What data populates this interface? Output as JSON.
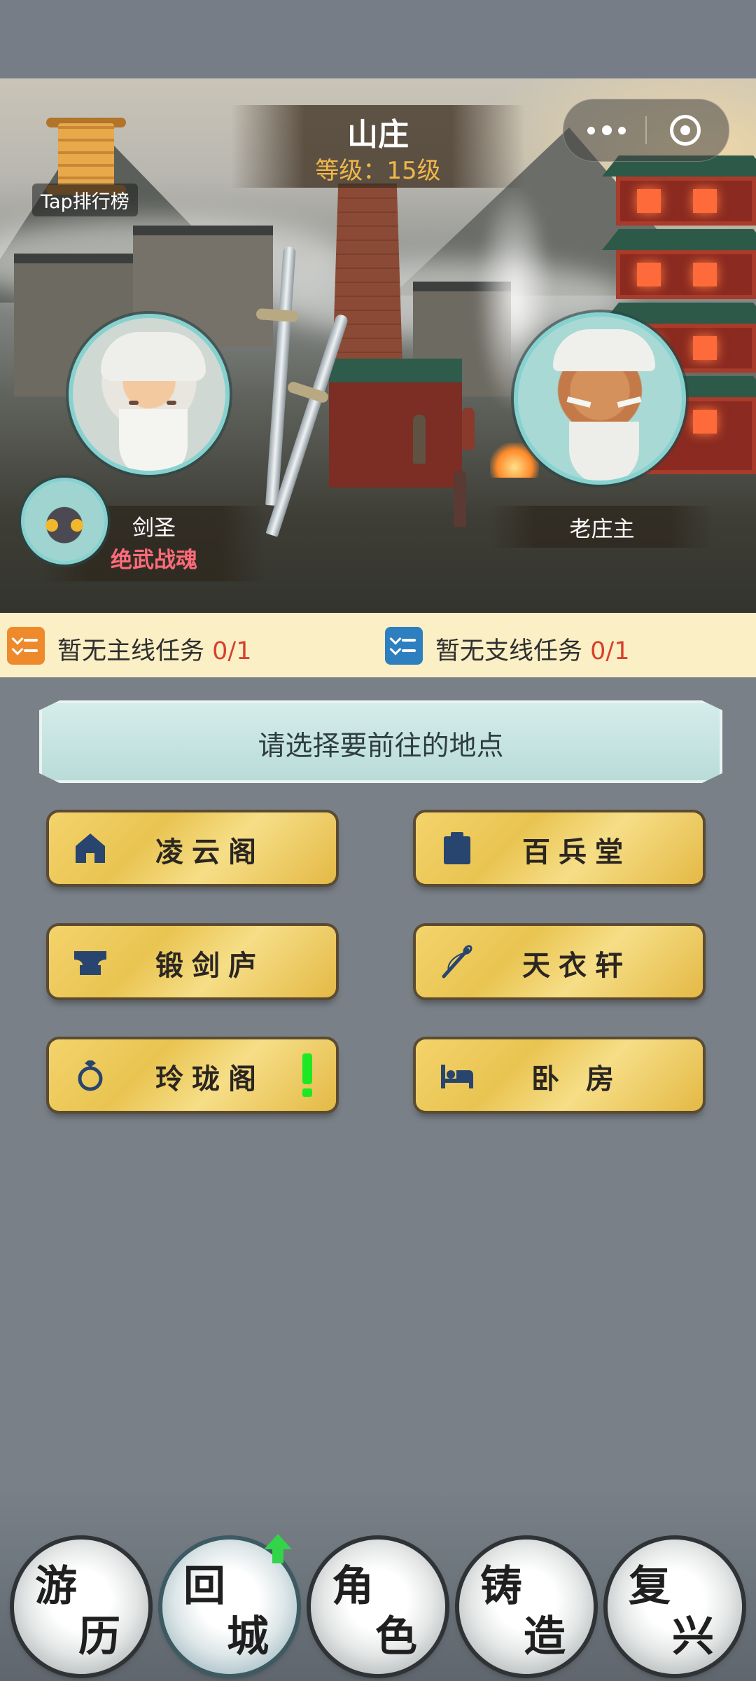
{
  "header": {
    "title": "山庄",
    "level": "等级：15级",
    "leaderboard_label": "Tap排行榜"
  },
  "capsule": {
    "more_icon": "more-dots-icon",
    "close_icon": "target-close-icon"
  },
  "npcs": [
    {
      "name": "剑圣",
      "title": "绝武战魂"
    },
    {
      "name": "老庄主"
    }
  ],
  "tasks": [
    {
      "text": "暂无主线任务",
      "count": "0/1",
      "icon_color": "#ee8a2c"
    },
    {
      "text": "暂无支线任务",
      "count": "0/1",
      "icon_color": "#2d7fc0"
    }
  ],
  "prompt": "请选择要前往的地点",
  "locations": [
    {
      "label": "凌云阁",
      "icon": "house-icon"
    },
    {
      "label": "百兵堂",
      "icon": "clipboard-icon"
    },
    {
      "label": "锻剑庐",
      "icon": "anvil-icon"
    },
    {
      "label": "天衣轩",
      "icon": "needle-icon"
    },
    {
      "label": "玲珑阁",
      "icon": "ring-icon",
      "alert": true
    },
    {
      "label": "卧 房",
      "icon": "bed-icon"
    }
  ],
  "nav": [
    {
      "c1": "游",
      "c2": "历"
    },
    {
      "c1": "回",
      "c2": "城",
      "active": true,
      "badge": "up-arrow-icon"
    },
    {
      "c1": "角",
      "c2": "色"
    },
    {
      "c1": "铸",
      "c2": "造"
    },
    {
      "c1": "复",
      "c2": "兴"
    }
  ],
  "colors": {
    "accent_gold": "#f0b84a",
    "task_count": "#d9402c",
    "alert_green": "#1ee823",
    "npc_title": "#ff6b7a"
  }
}
